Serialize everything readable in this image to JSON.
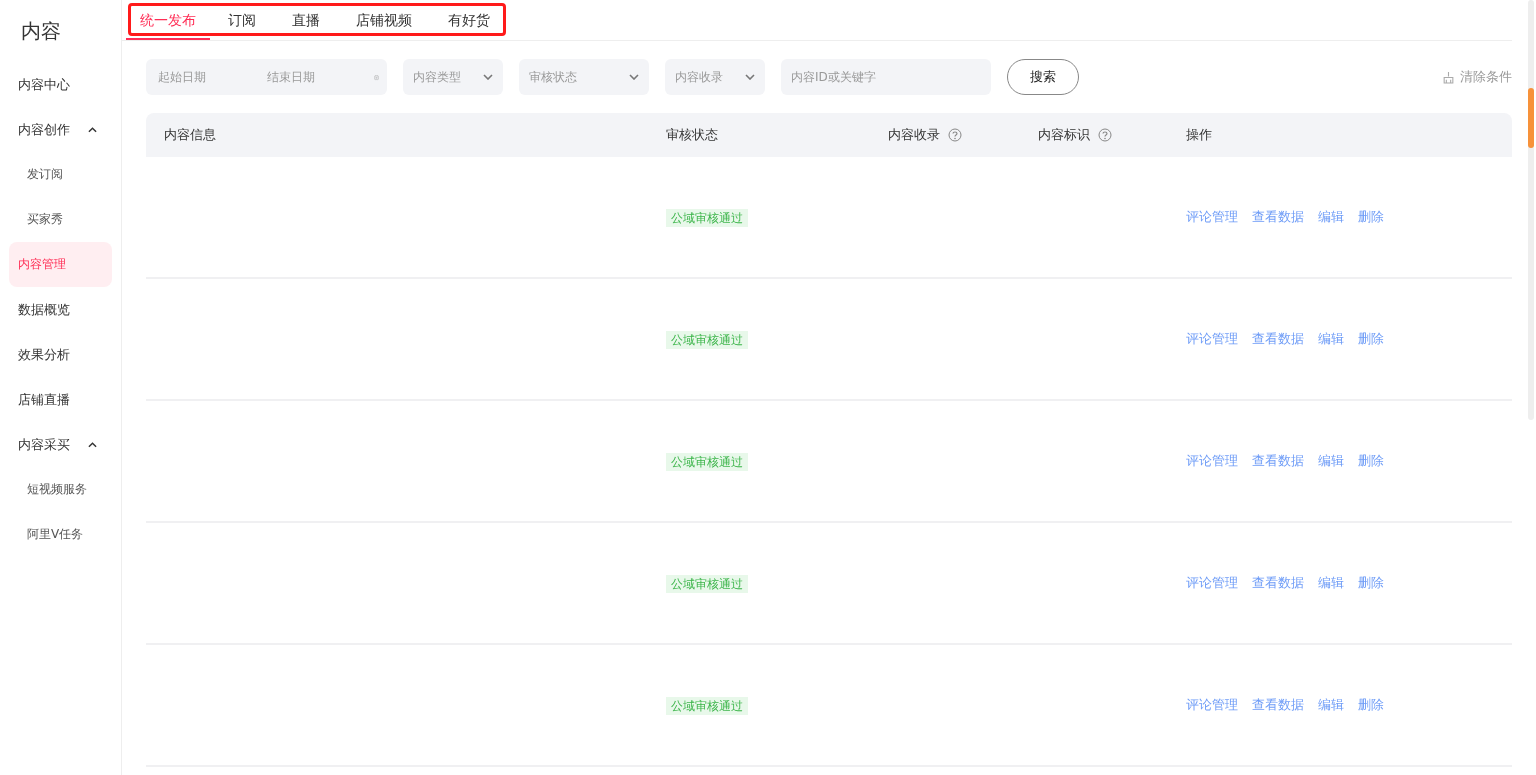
{
  "sidebar": {
    "title": "内容",
    "items": [
      {
        "label": "内容中心",
        "kind": "item",
        "selected": false
      },
      {
        "label": "内容创作",
        "kind": "group",
        "expanded": true,
        "children": [
          {
            "label": "发订阅",
            "selected": false
          },
          {
            "label": "买家秀",
            "selected": false
          },
          {
            "label": "内容管理",
            "selected": true
          }
        ]
      },
      {
        "label": "数据概览",
        "kind": "item",
        "selected": false
      },
      {
        "label": "效果分析",
        "kind": "item",
        "selected": false
      },
      {
        "label": "店铺直播",
        "kind": "item",
        "selected": false
      },
      {
        "label": "内容采买",
        "kind": "group",
        "expanded": true,
        "children": [
          {
            "label": "短视频服务",
            "selected": false
          },
          {
            "label": "阿里V任务",
            "selected": false
          }
        ]
      }
    ]
  },
  "tabs": [
    {
      "label": "统一发布",
      "selected": true
    },
    {
      "label": "订阅",
      "selected": false
    },
    {
      "label": "直播",
      "selected": false
    },
    {
      "label": "店铺视频",
      "selected": false
    },
    {
      "label": "有好货",
      "selected": false
    }
  ],
  "filters": {
    "start_date": {
      "placeholder": "起始日期"
    },
    "end_date": {
      "placeholder": "结束日期"
    },
    "selects": [
      {
        "placeholder": "内容类型"
      },
      {
        "placeholder": "审核状态"
      },
      {
        "placeholder": "内容收录"
      }
    ],
    "keyword": {
      "placeholder": "内容ID或关键字"
    },
    "search_button": "搜索",
    "clear": "清除条件"
  },
  "table": {
    "columns": [
      {
        "label": "内容信息",
        "help": false
      },
      {
        "label": "审核状态",
        "help": false
      },
      {
        "label": "内容收录",
        "help": true
      },
      {
        "label": "内容标识",
        "help": true
      },
      {
        "label": "操作",
        "help": false
      }
    ],
    "rows": [
      {
        "status": "公域审核通过",
        "actions": [
          "评论管理",
          "查看数据",
          "编辑",
          "删除"
        ]
      },
      {
        "status": "公域审核通过",
        "actions": [
          "评论管理",
          "查看数据",
          "编辑",
          "删除"
        ]
      },
      {
        "status": "公域审核通过",
        "actions": [
          "评论管理",
          "查看数据",
          "编辑",
          "删除"
        ]
      },
      {
        "status": "公域审核通过",
        "actions": [
          "评论管理",
          "查看数据",
          "编辑",
          "删除"
        ]
      },
      {
        "status": "公域审核通过",
        "actions": [
          "评论管理",
          "查看数据",
          "编辑",
          "删除"
        ]
      }
    ]
  }
}
